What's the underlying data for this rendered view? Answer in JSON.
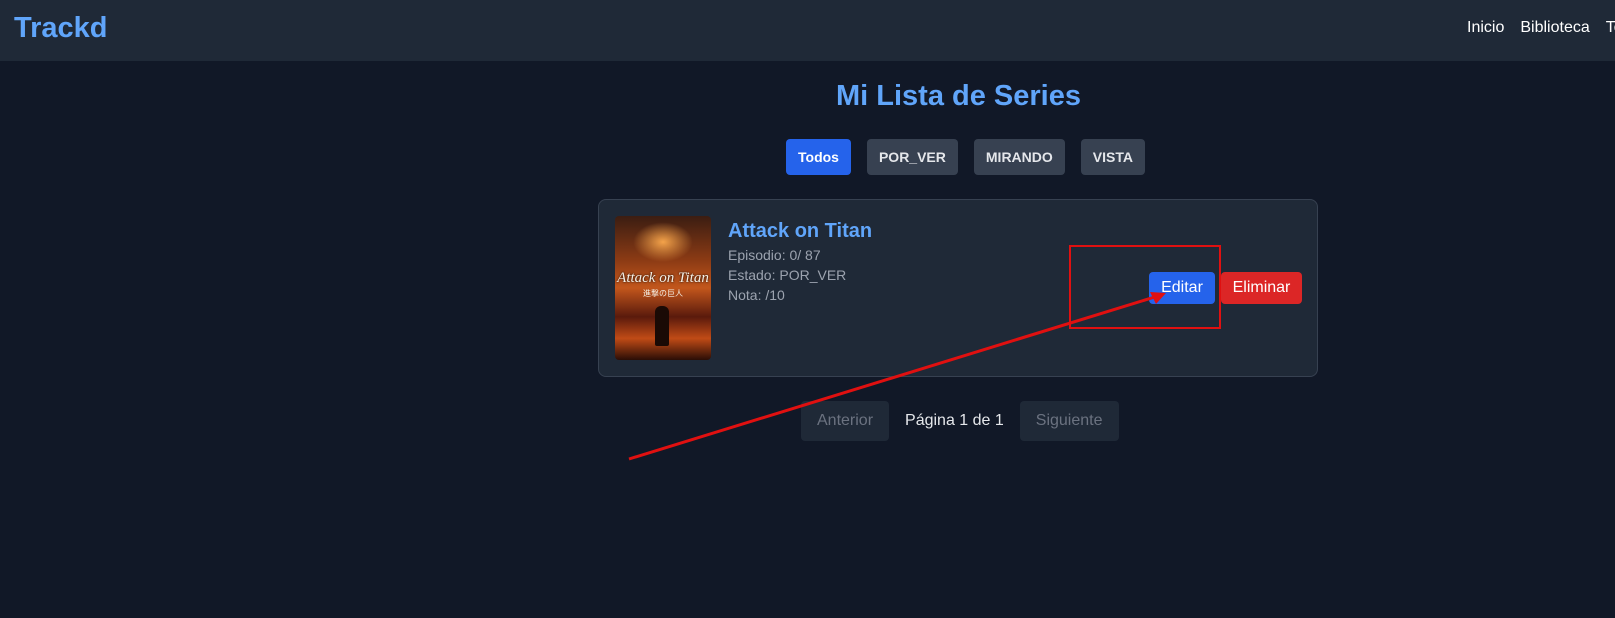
{
  "navbar": {
    "brand": "Trackd",
    "links": [
      "Inicio",
      "Biblioteca",
      "To"
    ]
  },
  "page": {
    "title": "Mi Lista de Series"
  },
  "filters": [
    "Todos",
    "POR_VER",
    "MIRANDO",
    "VISTA"
  ],
  "active_filter": "Todos",
  "series": [
    {
      "title": "Attack on Titan",
      "poster_logo": "Attack on Titan",
      "poster_subtitle": "進撃の巨人",
      "episode_line": "Episodio: 0/ 87",
      "status_line": "Estado: POR_VER",
      "score_line": "Nota: /10",
      "edit_label": "Editar",
      "delete_label": "Eliminar"
    }
  ],
  "pagination": {
    "prev_label": "Anterior",
    "info": "Página 1 de 1",
    "next_label": "Siguiente"
  },
  "colors": {
    "background": "#111827",
    "navbar": "#1f2937",
    "accent": "#60a5fa",
    "primary_button": "#2563eb",
    "danger_button": "#dc2626",
    "annotation": "#e01010"
  },
  "annotation": {
    "shape": "red rectangle around edit button with arrow pointing to it"
  }
}
